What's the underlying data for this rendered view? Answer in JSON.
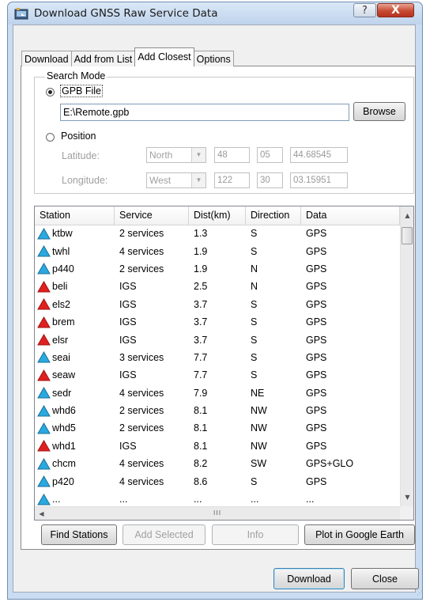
{
  "window": {
    "title": "Download GNSS Raw Service Data",
    "help_glyph": "?",
    "close_glyph": "X"
  },
  "tabs": [
    {
      "label": "Download",
      "active": false
    },
    {
      "label": "Add from List",
      "active": false
    },
    {
      "label": "Add Closest",
      "active": true
    },
    {
      "label": "Options",
      "active": false
    }
  ],
  "search_mode": {
    "title": "Search Mode",
    "gpb_file_label": "GPB File",
    "gpb_file_selected": true,
    "file_path": "E:\\Remote.gpb",
    "browse_label": "Browse",
    "position_label": "Position",
    "latitude_label": "Latitude:",
    "latitude_hemisphere": "North",
    "latitude_deg": "48",
    "latitude_min": "05",
    "latitude_sec": "44.68545",
    "longitude_label": "Longitude:",
    "longitude_hemisphere": "West",
    "longitude_deg": "122",
    "longitude_min": "30",
    "longitude_sec": "03.15951"
  },
  "list": {
    "columns": [
      "Station",
      "Service",
      "Dist(km)",
      "Direction",
      "Data"
    ],
    "rows": [
      {
        "station": "ktbw",
        "icon": "blue-triangle-icon",
        "service": "2 services",
        "dist": "1.3",
        "direction": "S",
        "data": "GPS"
      },
      {
        "station": "twhl",
        "icon": "blue-triangle-icon",
        "service": "4 services",
        "dist": "1.9",
        "direction": "S",
        "data": "GPS"
      },
      {
        "station": "p440",
        "icon": "blue-triangle-icon",
        "service": "2 services",
        "dist": "1.9",
        "direction": "N",
        "data": "GPS"
      },
      {
        "station": "beli",
        "icon": "red-triangle-icon",
        "service": "IGS",
        "dist": "2.5",
        "direction": "N",
        "data": "GPS"
      },
      {
        "station": "els2",
        "icon": "red-triangle-icon",
        "service": "IGS",
        "dist": "3.7",
        "direction": "S",
        "data": "GPS"
      },
      {
        "station": "brem",
        "icon": "red-triangle-icon",
        "service": "IGS",
        "dist": "3.7",
        "direction": "S",
        "data": "GPS"
      },
      {
        "station": "elsr",
        "icon": "red-triangle-icon",
        "service": "IGS",
        "dist": "3.7",
        "direction": "S",
        "data": "GPS"
      },
      {
        "station": "seai",
        "icon": "blue-triangle-icon",
        "service": "3 services",
        "dist": "7.7",
        "direction": "S",
        "data": "GPS"
      },
      {
        "station": "seaw",
        "icon": "red-triangle-icon",
        "service": "IGS",
        "dist": "7.7",
        "direction": "S",
        "data": "GPS"
      },
      {
        "station": "sedr",
        "icon": "blue-triangle-icon",
        "service": "4 services",
        "dist": "7.9",
        "direction": "NE",
        "data": "GPS"
      },
      {
        "station": "whd6",
        "icon": "blue-triangle-icon",
        "service": "2 services",
        "dist": "8.1",
        "direction": "NW",
        "data": "GPS"
      },
      {
        "station": "whd5",
        "icon": "blue-triangle-icon",
        "service": "2 services",
        "dist": "8.1",
        "direction": "NW",
        "data": "GPS"
      },
      {
        "station": "whd1",
        "icon": "red-triangle-icon",
        "service": "IGS",
        "dist": "8.1",
        "direction": "NW",
        "data": "GPS"
      },
      {
        "station": "chcm",
        "icon": "blue-triangle-icon",
        "service": "4 services",
        "dist": "8.2",
        "direction": "SW",
        "data": "GPS+GLO"
      },
      {
        "station": "p420",
        "icon": "blue-triangle-icon",
        "service": "4 services",
        "dist": "8.6",
        "direction": "S",
        "data": "GPS"
      },
      {
        "station": "...",
        "icon": "blue-triangle-icon",
        "service": "...",
        "dist": "...",
        "direction": "...",
        "data": "..."
      }
    ],
    "hscroll_grip": "III"
  },
  "actions": {
    "find_stations": "Find Stations",
    "add_selected": "Add Selected",
    "info": "Info",
    "plot_google_earth": "Plot in Google Earth"
  },
  "footer": {
    "download": "Download",
    "close": "Close"
  },
  "colors": {
    "station_blue": "#29a9e0",
    "station_red": "#e02020"
  }
}
